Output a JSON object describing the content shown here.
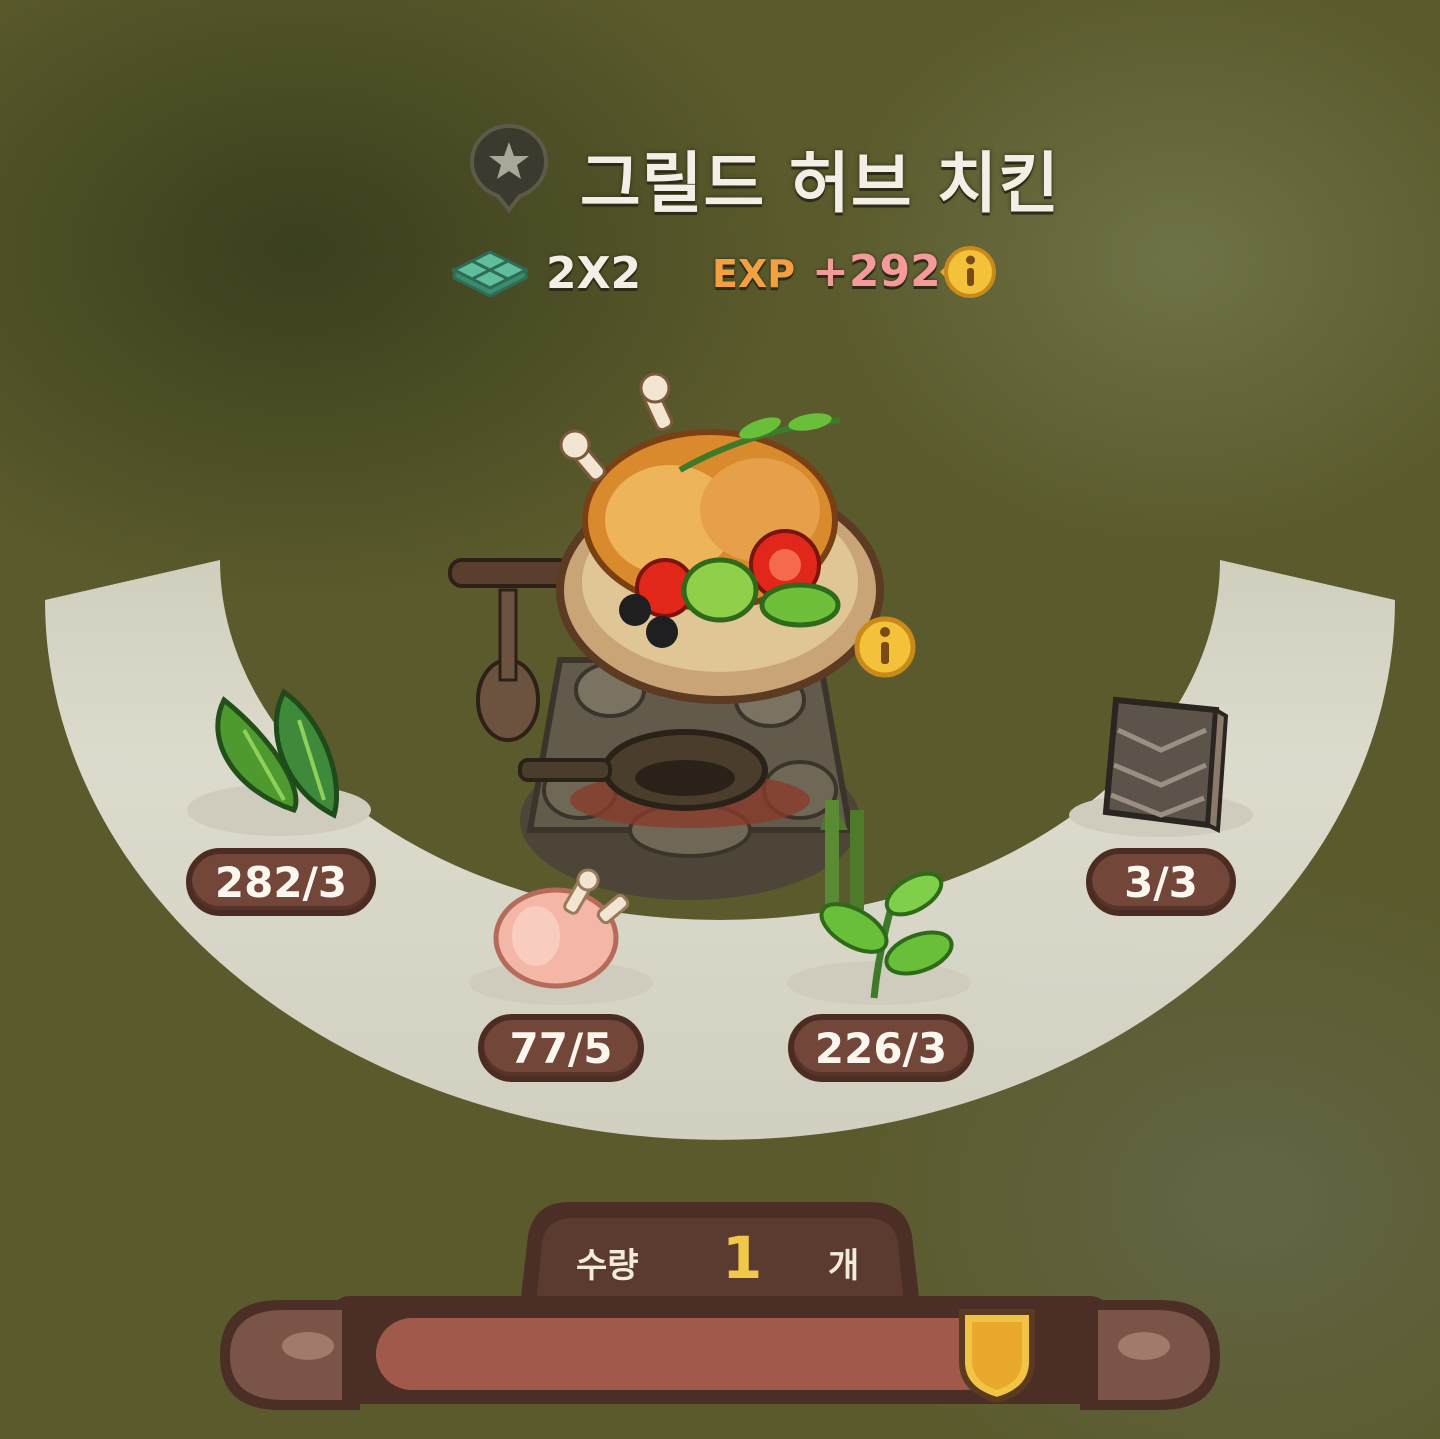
{
  "recipe": {
    "name": "그릴드 허브 치킨",
    "size": "2X2",
    "exp_label": "EXP",
    "exp_value": "+292"
  },
  "ingredients": [
    {
      "name": "spinach",
      "count": "282/3"
    },
    {
      "name": "raw-chicken",
      "count": "77/5"
    },
    {
      "name": "herb",
      "count": "226/3"
    },
    {
      "name": "wooden-plank",
      "count": "3/3"
    }
  ],
  "quantity": {
    "label": "수량",
    "value": "1",
    "unit": "개",
    "slider_fraction": 1.0
  },
  "colors": {
    "background": "#5a5a2c",
    "ring": "#e4e2d6",
    "badge": "#73463a",
    "exp_value": "#f49a9a",
    "accent_gold": "#f0c84b"
  }
}
